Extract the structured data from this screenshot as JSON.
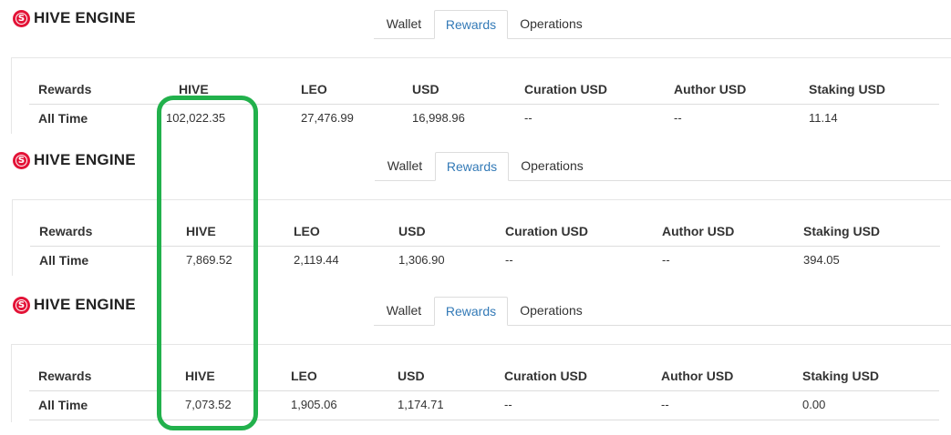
{
  "brand": {
    "name": "HIVE ENGINE",
    "color": "#e31337"
  },
  "tabs": [
    "Wallet",
    "Rewards",
    "Operations"
  ],
  "active_tab": "Rewards",
  "columns": [
    "Rewards",
    "HIVE",
    "LEO",
    "USD",
    "Curation USD",
    "Author USD",
    "Staking USD"
  ],
  "snapshots": [
    {
      "row_label": "All Time",
      "hive": "102,022.35",
      "leo": "27,476.99",
      "usd": "16,998.96",
      "curation_usd": "--",
      "author_usd": "--",
      "staking_usd": "11.14"
    },
    {
      "row_label": "All Time",
      "hive": "7,869.52",
      "leo": "2,119.44",
      "usd": "1,306.90",
      "curation_usd": "--",
      "author_usd": "--",
      "staking_usd": "394.05"
    },
    {
      "row_label": "All Time",
      "hive": "7,073.52",
      "leo": "1,905.06",
      "usd": "1,174.71",
      "curation_usd": "--",
      "author_usd": "--",
      "staking_usd": "0.00"
    }
  ],
  "colors": {
    "accent": "#337ab7",
    "highlight": "#22b14c",
    "border": "#dddddd"
  }
}
